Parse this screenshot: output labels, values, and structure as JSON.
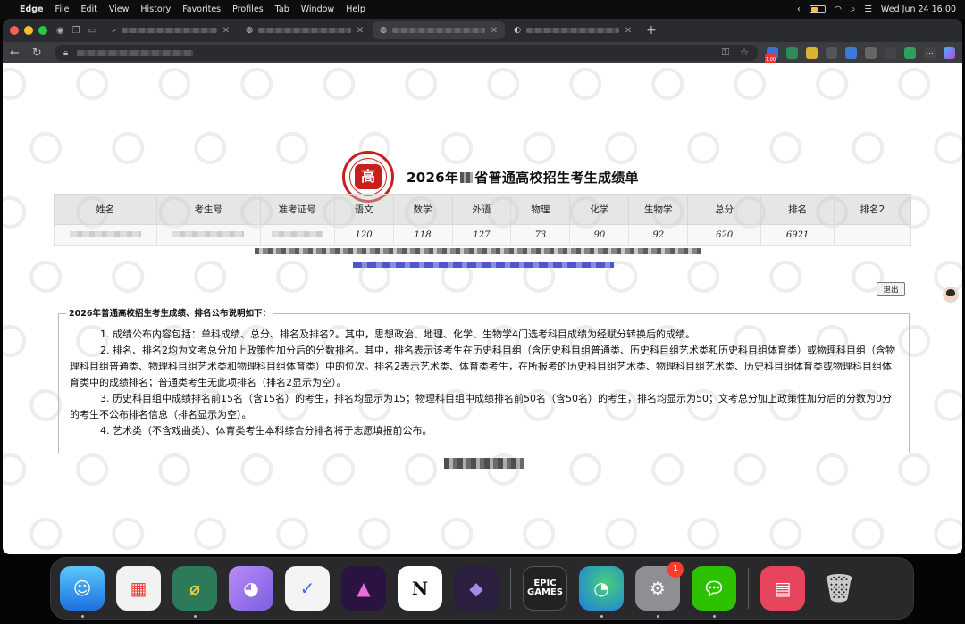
{
  "menubar": {
    "app_name": "Edge",
    "menus": [
      "File",
      "Edit",
      "View",
      "History",
      "Favorites",
      "Profiles",
      "Tab",
      "Window",
      "Help"
    ],
    "clock": "Wed Jun 24  16:00"
  },
  "browser": {
    "extension_badge": "1.00"
  },
  "page": {
    "title_prefix": "2026年",
    "title_suffix": "省普通高校招生考生成绩单",
    "emblem_glyph": "高",
    "table": {
      "headers": [
        "姓名",
        "考生号",
        "准考证号",
        "语文",
        "数学",
        "外语",
        "物理",
        "化学",
        "生物学",
        "总分",
        "排名",
        "排名2"
      ],
      "row": [
        "",
        "",
        "",
        "120",
        "118",
        "127",
        "73",
        "90",
        "92",
        "620",
        "6921",
        ""
      ]
    },
    "logout_label": "退出",
    "notes": {
      "legend": "2026年普通高校招生考生成绩、排名公布说明如下：",
      "items": [
        "1. 成绩公布内容包括：单科成绩、总分、排名及排名2。其中，思想政治、地理、化学、生物学4门选考科目成绩为经赋分转换后的成绩。",
        "2. 排名、排名2均为文考总分加上政策性加分后的分数排名。其中，排名表示该考生在历史科目组（含历史科目组普通类、历史科目组艺术类和历史科目组体育类）或物理科目组（含物理科目组普通类、物理科目组艺术类和物理科目组体育类）中的位次。排名2表示艺术类、体育类考生，在所报考的历史科目组艺术类、物理科目组艺术类、历史科目组体育类或物理科目组体育类中的成绩排名；普通类考生无此项排名（排名2显示为空）。",
        "3. 历史科目组中成绩排名前15名（含15名）的考生，排名均显示为15；物理科目组中成绩排名前50名（含50名）的考生，排名均显示为50；文考总分加上政策性加分后的分数为0分的考生不公布排名信息（排名显示为空）。",
        "4. 艺术类（不含戏曲类）、体育类考生本科综合分排名将于志愿填报前公布。"
      ]
    }
  },
  "dock": {
    "epic_label": "EPIC\nGAMES",
    "settings_badge": "1"
  },
  "colors": {
    "emblem_red": "#c7201c",
    "link_blue": "#3a44c8",
    "badge_red": "#ff3b30"
  }
}
